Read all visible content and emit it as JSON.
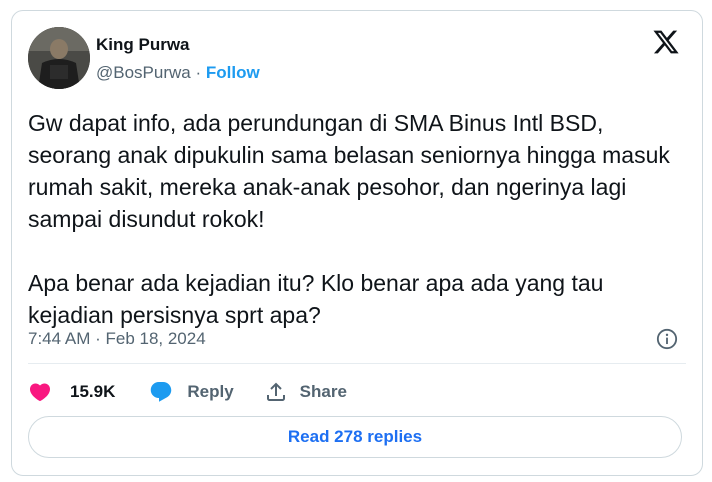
{
  "author": {
    "name": "King Purwa",
    "handle": "@BosPurwa",
    "separator": "·",
    "follow_label": "Follow"
  },
  "brand": {
    "icon": "x-logo-icon",
    "color": "#0f1419"
  },
  "tweet": {
    "paragraphs": [
      "Gw dapat info, ada perundungan di SMA Binus Intl BSD, seorang anak dipukulin sama belasan seniornya hingga masuk rumah sakit, mereka anak-anak pesohor, dan ngerinya lagi sampai disundut rokok!",
      "Apa benar ada kejadian itu? Klo benar apa ada yang tau kejadian persisnya sprt apa?"
    ],
    "timestamp": "7:44 AM · Feb 18, 2024"
  },
  "actions": {
    "like_count": "15.9K",
    "reply_label": "Reply",
    "share_label": "Share"
  },
  "read_replies_label": "Read 278 replies",
  "colors": {
    "accent": "#1d9bf0",
    "like": "#f91880",
    "reply": "#1d9bf0",
    "muted": "#536471",
    "border": "#cfd9de"
  }
}
